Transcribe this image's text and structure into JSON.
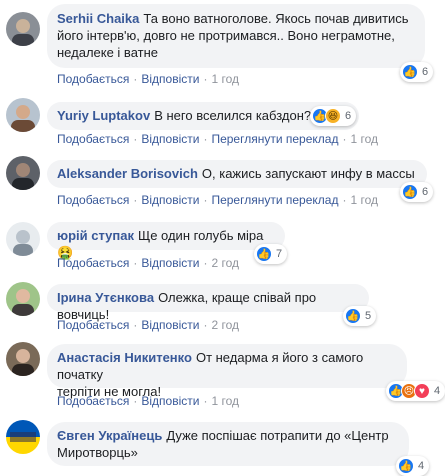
{
  "common": {
    "like_label": "Подобається",
    "reply_label": "Відповісти",
    "translate_label": "Переглянути переклад",
    "dot": "·"
  },
  "comments": [
    {
      "author": "Serhii Chaika",
      "lines": [
        "Та воно ватноголове. Якось почав дивитись",
        "його інтерв'ю, довго не протримався.. Воно неграмотне,",
        "недалеке і ватне"
      ],
      "time": "1 год",
      "reactions": [
        "like"
      ],
      "count": "6"
    },
    {
      "author": "Yuriy Luptakov",
      "lines": [
        "В него вселился кабздон?"
      ],
      "time": "1 год",
      "reactions": [
        "like",
        "haha"
      ],
      "count": "6"
    },
    {
      "author": "Aleksander Borisovich",
      "lines": [
        "О, кажись запускают инфу в массы"
      ],
      "time": "1 год",
      "reactions": [
        "like"
      ],
      "count": "6"
    },
    {
      "author": "юрій ступак",
      "lines": [
        "Ще один голубь міра🤮"
      ],
      "time": "2 год",
      "reactions": [
        "like"
      ],
      "count": "7"
    },
    {
      "author": "Ірина Утєнкова",
      "lines": [
        "Олежка, краще співай про вовчиць!"
      ],
      "time": "2 год",
      "reactions": [
        "like"
      ],
      "count": "5"
    },
    {
      "author": "Анастасія Никитенко",
      "lines": [
        "От недарма я його з самого початку",
        "терпіти не могла!"
      ],
      "time": "1 год",
      "reactions": [
        "like",
        "angry",
        "love"
      ],
      "count": "4"
    },
    {
      "author": "Євген Українець",
      "lines": [
        "Дуже поспішає потрапити до «Центр",
        "Миротворць»"
      ],
      "time": "",
      "reactions": [
        "like"
      ],
      "count": "4"
    }
  ]
}
